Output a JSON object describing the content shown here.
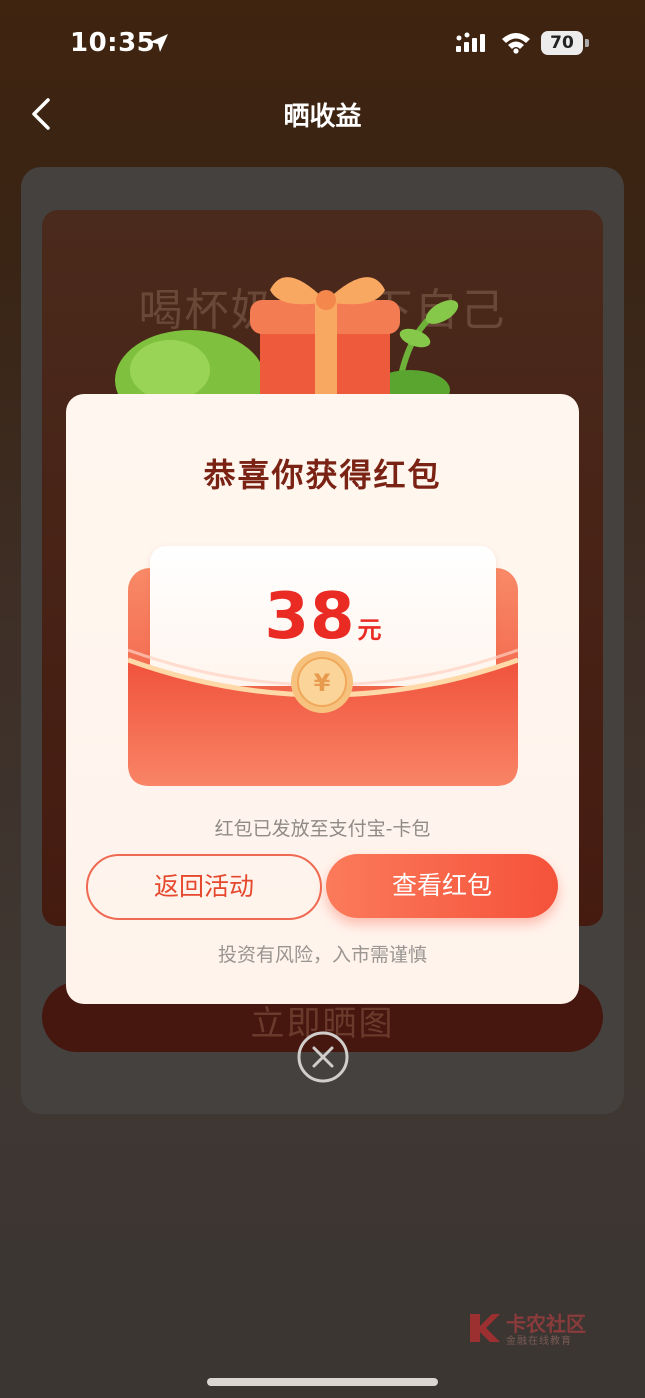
{
  "status_bar": {
    "time": "10:35",
    "battery": "70"
  },
  "nav": {
    "title": "晒收益"
  },
  "background_page": {
    "headline": "喝杯奶茶…下自己",
    "share_button_label": "立即晒图"
  },
  "popup": {
    "title": "恭喜你获得红包",
    "amount": "38",
    "amount_unit": "元",
    "notice": "红包已发放至支付宝-卡包",
    "return_button": "返回活动",
    "view_button": "查看红包",
    "disclaimer": "投资有风险，入市需谨慎"
  },
  "watermark": {
    "name": "卡农社区",
    "subtitle": "金融在线教育"
  },
  "colors": {
    "accent": "#f5523a",
    "title": "#7a2315",
    "amount": "#ea2b24"
  }
}
